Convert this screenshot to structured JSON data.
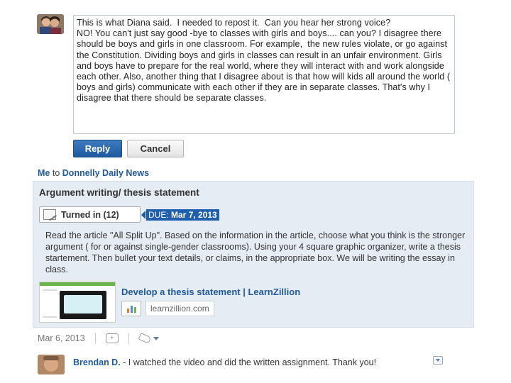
{
  "reply": {
    "text": "This is what Diana said.  I needed to repost it.  Can you hear her strong voice?\nNO! You can't just say good -bye to classes with girls and boys.... can you? I disagree there should be boys and girls in one classroom. For example,  the new rules violate, or go against the Constitution. Dividing boys and girls in classes can result in an unfair environment. Girls and boys have to prepare for the real world, where they will interact with and work alongside each other. Also, another thing that I disagree about is that how will kids all around the world ( boys and girls) communicate with each other if they are in separate classes. That's why I disagree that there should be separate classes.",
    "reply_label": "Reply",
    "cancel_label": "Cancel"
  },
  "post": {
    "sender": "Me",
    "to_word": "to",
    "recipient": "Donnelly Daily News",
    "title": "Argument writing/ thesis statement",
    "turned_in_label": "Turned in (12)",
    "due_prefix": "DUE:",
    "due_date": "Mar 7, 2013",
    "body": "Read the article \"All Split Up\". Based on the information in the article, choose what you think is the stronger argument ( for or against single-gender classrooms). Using your 4 square graphic organizer, write a thesis startement. Then bullet your text details, or claims, in the appropriate box. We will be writing the essay in class.",
    "link_title": "Develop a thesis statement | LearnZillion",
    "link_domain": "learnzillion.com",
    "date": "Mar 6, 2013",
    "icons": {
      "comment": "comment-add-icon",
      "tag": "tag-icon"
    }
  },
  "comment": {
    "author": "Brendan D.",
    "text": " - I watched the video and did the written assignment. Thank you!"
  },
  "colors": {
    "link_blue": "#1f5a9c",
    "post_bg": "#e6ecf3",
    "due_bg": "#1f5fae",
    "reply_button": "#2d6aaf"
  }
}
